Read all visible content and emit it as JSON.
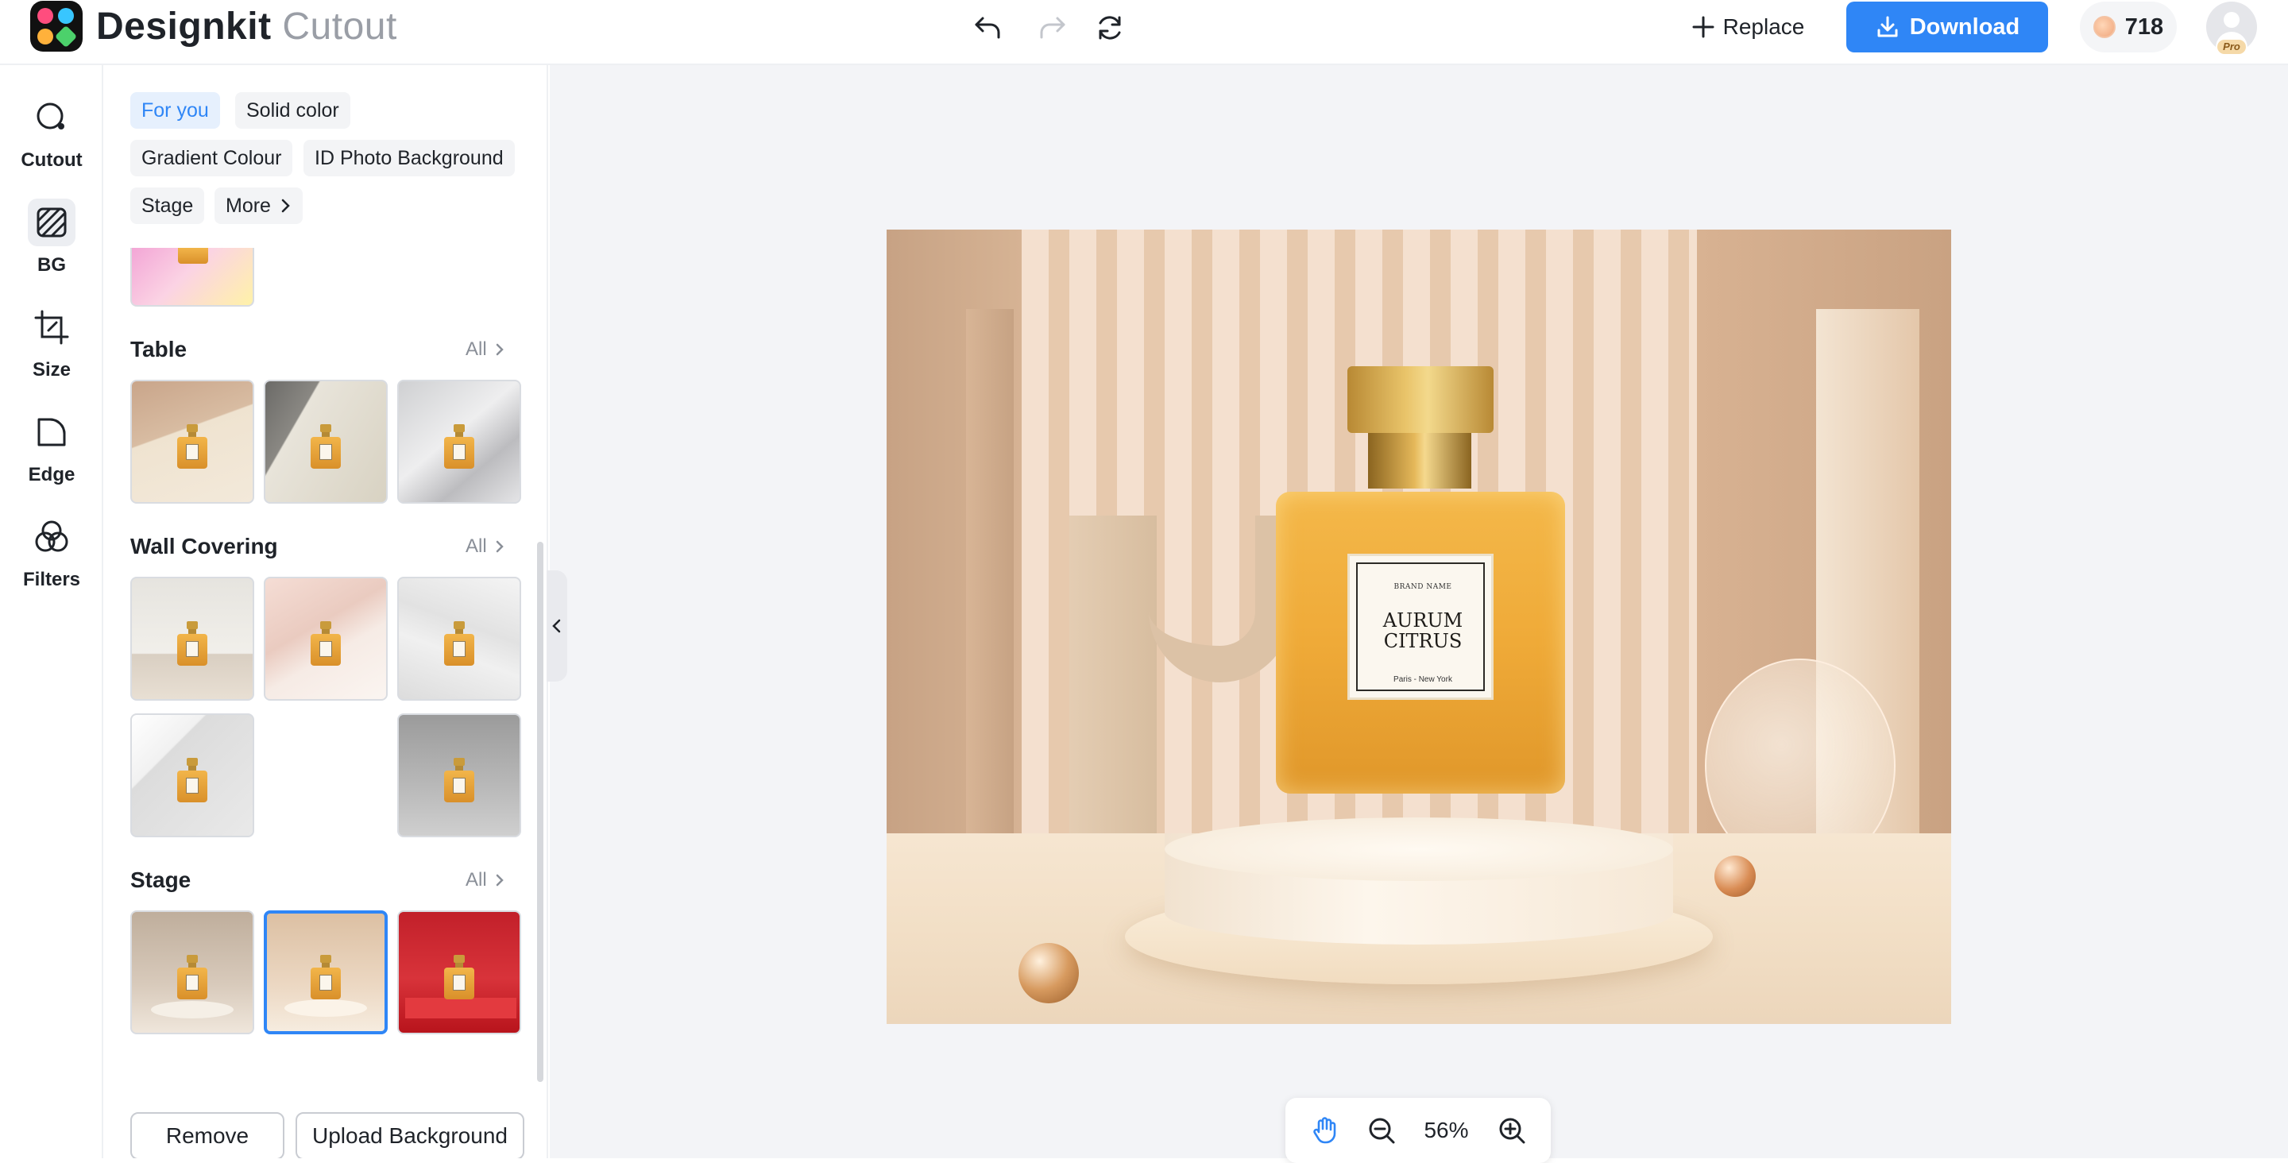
{
  "app": {
    "name": "Designkit",
    "module": "Cutout"
  },
  "toolbar": {
    "undo_icon": "undo-icon",
    "redo_icon": "redo-icon",
    "reset_icon": "refresh-icon",
    "replace_label": "Replace",
    "download_label": "Download",
    "credits": "718",
    "pro_badge": "Pro"
  },
  "rail": {
    "items": [
      {
        "label": "Cutout",
        "icon": "cutout-icon"
      },
      {
        "label": "BG",
        "icon": "background-icon"
      },
      {
        "label": "Size",
        "icon": "crop-icon"
      },
      {
        "label": "Edge",
        "icon": "edge-icon"
      },
      {
        "label": "Filters",
        "icon": "filters-icon"
      }
    ],
    "active": "BG"
  },
  "panel": {
    "chips": [
      "For you",
      "Solid color",
      "Gradient Colour",
      "ID Photo Background",
      "Stage",
      "More"
    ],
    "active_chip": "For you",
    "sections": [
      {
        "title": "Table",
        "all_label": "All"
      },
      {
        "title": "Wall Covering",
        "all_label": "All"
      },
      {
        "title": "Stage",
        "all_label": "All"
      }
    ],
    "remove_label": "Remove",
    "upload_label": "Upload Background"
  },
  "canvas": {
    "label_brand": "BRAND NAME",
    "label_line1": "AURUM",
    "label_line2": "CITRUS",
    "label_city": "Paris - New York"
  },
  "zoom": {
    "value": "56%",
    "hand_icon": "hand-icon",
    "zoom_out_icon": "zoom-out-icon",
    "zoom_in_icon": "zoom-in-icon"
  },
  "colors": {
    "accent": "#2f86f6",
    "chip_active_bg": "#e6f0fd"
  }
}
